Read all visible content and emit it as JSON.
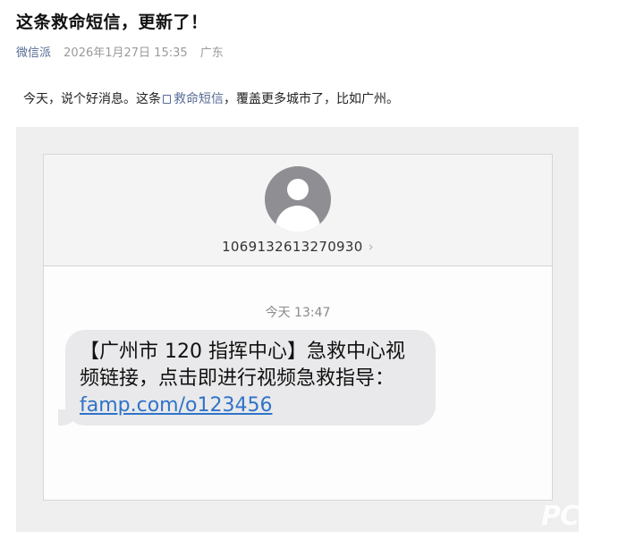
{
  "article": {
    "title": "这条救命短信，更新了！",
    "author": "微信派",
    "date": "2026年1月27日 15:35",
    "location": "广东",
    "intro_before": "今天，说个好消息。这条",
    "intro_link": "救命短信",
    "intro_after": "，覆盖更多城市了，比如广州。"
  },
  "sms": {
    "sender_number": "1069132613270930",
    "chevron": "›",
    "timestamp": "今天 13:47",
    "message_line1": "【广州市 120 指挥中心】急救中心视",
    "message_line2": "频链接，点击即进行视频急救指导：",
    "message_url": "famp.com/o123456"
  },
  "watermark": {
    "text": "PC"
  },
  "colors": {
    "link": "#576b95",
    "url": "#2f73c9",
    "bubble": "#e9e9eb",
    "avatar": "#8e8e93"
  },
  "icons": {
    "avatar": "person-avatar-icon",
    "chevron": "chevron-right-icon",
    "link": "link-doc-icon"
  }
}
